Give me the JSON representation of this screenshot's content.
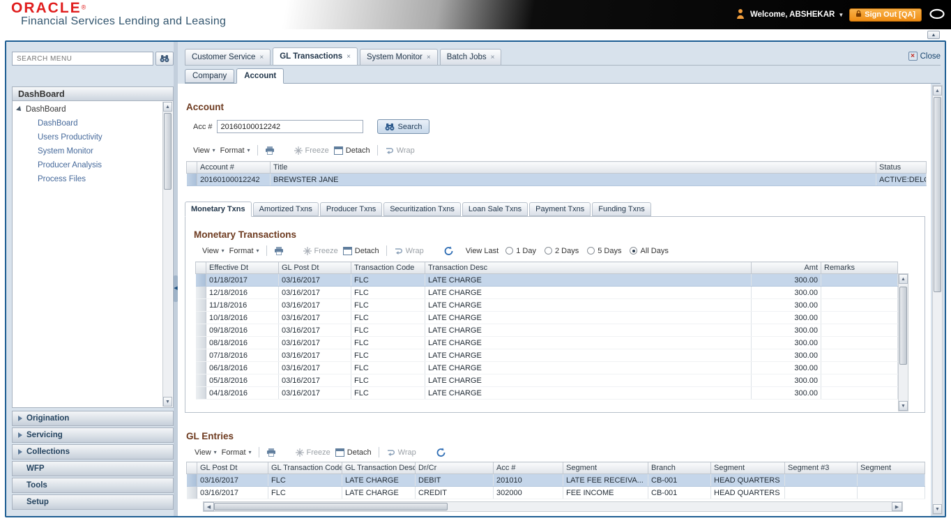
{
  "header": {
    "brand": "ORACLE",
    "registered": "®",
    "product": "Financial Services Lending and Leasing",
    "welcome": "Welcome, ABSHEKAR",
    "sign_out": "Sign Out [QA]"
  },
  "icons": {
    "tab_close": "×",
    "close_x": "×",
    "dropdown": "▾",
    "welcome_caret": "▼",
    "scroll_up": "▲",
    "scroll_down": "▼",
    "scroll_left": "◀",
    "scroll_right": "▶",
    "splitter": "◀"
  },
  "colors": {
    "accent_blue": "#1d5d92",
    "signout_orange": "#ef8d13",
    "brand_red": "#e01e1e",
    "selected_row": "#c5d6ea",
    "heading_brown": "#6d3a1f"
  },
  "sidebar": {
    "search_placeholder": "SEARCH MENU",
    "panel_title": "DashBoard",
    "tree": {
      "root": "DashBoard",
      "items": [
        "DashBoard",
        "Users Productivity",
        "System Monitor",
        "Producer Analysis",
        "Process Files"
      ]
    },
    "accordions": [
      {
        "label": "Origination",
        "arrow": true
      },
      {
        "label": "Servicing",
        "arrow": true
      },
      {
        "label": "Collections",
        "arrow": true
      },
      {
        "label": "WFP",
        "arrow": false
      },
      {
        "label": "Tools",
        "arrow": false
      },
      {
        "label": "Setup",
        "arrow": false
      }
    ]
  },
  "tabs": {
    "items": [
      {
        "label": "Customer Service",
        "active": false
      },
      {
        "label": "GL Transactions",
        "active": true
      },
      {
        "label": "System Monitor",
        "active": false
      },
      {
        "label": "Batch Jobs",
        "active": false
      }
    ],
    "close_label": "Close"
  },
  "subtabs": {
    "items": [
      {
        "label": "Company",
        "active": false
      },
      {
        "label": "Account",
        "active": true
      }
    ]
  },
  "toolbar": {
    "view": "View",
    "format": "Format",
    "freeze": "Freeze",
    "detach": "Detach",
    "wrap": "Wrap"
  },
  "account": {
    "heading": "Account",
    "acc_label": "Acc #",
    "acc_value": "20160100012242",
    "search_label": "Search",
    "columns": [
      "Account #",
      "Title",
      "Status"
    ],
    "rows": [
      [
        "20160100012242",
        "BREWSTER JANE",
        "ACTIVE:DELQ"
      ]
    ]
  },
  "txn_tabs": {
    "items": [
      {
        "label": "Monetary Txns",
        "active": true
      },
      {
        "label": "Amortized Txns",
        "active": false
      },
      {
        "label": "Producer Txns",
        "active": false
      },
      {
        "label": "Securitization Txns",
        "active": false
      },
      {
        "label": "Loan Sale Txns",
        "active": false
      },
      {
        "label": "Payment Txns",
        "active": false
      },
      {
        "label": "Funding Txns",
        "active": false
      }
    ]
  },
  "monetary": {
    "heading": "Monetary Transactions",
    "view_last_label": "View Last",
    "view_last_options": [
      {
        "label": "1 Day",
        "selected": false
      },
      {
        "label": "2 Days",
        "selected": false
      },
      {
        "label": "5 Days",
        "selected": false
      },
      {
        "label": "All Days",
        "selected": true
      }
    ],
    "columns": [
      "Effective Dt",
      "GL Post Dt",
      "Transaction Code",
      "Transaction Desc",
      "Amt",
      "Remarks"
    ],
    "rows": [
      [
        "01/18/2017",
        "03/16/2017",
        "FLC",
        "LATE CHARGE",
        "300.00",
        ""
      ],
      [
        "12/18/2016",
        "03/16/2017",
        "FLC",
        "LATE CHARGE",
        "300.00",
        ""
      ],
      [
        "11/18/2016",
        "03/16/2017",
        "FLC",
        "LATE CHARGE",
        "300.00",
        ""
      ],
      [
        "10/18/2016",
        "03/16/2017",
        "FLC",
        "LATE CHARGE",
        "300.00",
        ""
      ],
      [
        "09/18/2016",
        "03/16/2017",
        "FLC",
        "LATE CHARGE",
        "300.00",
        ""
      ],
      [
        "08/18/2016",
        "03/16/2017",
        "FLC",
        "LATE CHARGE",
        "300.00",
        ""
      ],
      [
        "07/18/2016",
        "03/16/2017",
        "FLC",
        "LATE CHARGE",
        "300.00",
        ""
      ],
      [
        "06/18/2016",
        "03/16/2017",
        "FLC",
        "LATE CHARGE",
        "300.00",
        ""
      ],
      [
        "05/18/2016",
        "03/16/2017",
        "FLC",
        "LATE CHARGE",
        "300.00",
        ""
      ],
      [
        "04/18/2016",
        "03/16/2017",
        "FLC",
        "LATE CHARGE",
        "300.00",
        ""
      ]
    ]
  },
  "gl": {
    "heading": "GL Entries",
    "columns": [
      "GL Post Dt",
      "GL Transaction Code",
      "GL Transaction Desc",
      "Dr/Cr",
      "Acc #",
      "Segment",
      "Branch",
      "Segment",
      "Segment #3",
      "Segment"
    ],
    "rows": [
      [
        "03/16/2017",
        "FLC",
        "LATE CHARGE",
        "DEBIT",
        "201010",
        "LATE FEE RECEIVA...",
        "CB-001",
        "HEAD QUARTERS",
        "",
        ""
      ],
      [
        "03/16/2017",
        "FLC",
        "LATE CHARGE",
        "CREDIT",
        "302000",
        "FEE INCOME",
        "CB-001",
        "HEAD QUARTERS",
        "",
        ""
      ]
    ]
  }
}
